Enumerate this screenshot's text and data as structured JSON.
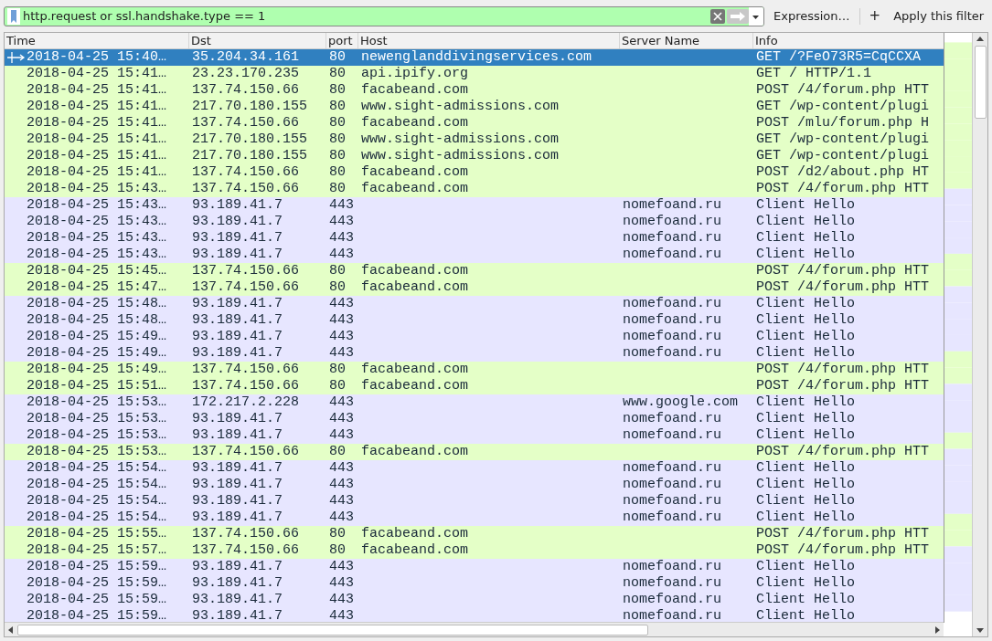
{
  "filter_bar": {
    "value": "http.request or ssl.handshake.type == 1",
    "expression_label": "Expression…",
    "add_label": "+",
    "apply_label": "Apply this filter"
  },
  "table": {
    "columns": [
      "Time",
      "Dst",
      "port",
      "Host",
      "Server Name",
      "Info"
    ],
    "rows": [
      {
        "time": "2018-04-25 15:40…",
        "dst": "35.204.34.161",
        "port": "80",
        "host": "newenglanddivingservices.com",
        "server_name": "",
        "info": "GET /?FeO73R5=CqCCXA",
        "kind": "http",
        "selected": true
      },
      {
        "time": "2018-04-25 15:41…",
        "dst": "23.23.170.235",
        "port": "80",
        "host": "api.ipify.org",
        "server_name": "",
        "info": "GET / HTTP/1.1",
        "kind": "http",
        "selected": false
      },
      {
        "time": "2018-04-25 15:41…",
        "dst": "137.74.150.66",
        "port": "80",
        "host": "facabeand.com",
        "server_name": "",
        "info": "POST /4/forum.php HTT",
        "kind": "http",
        "selected": false
      },
      {
        "time": "2018-04-25 15:41…",
        "dst": "217.70.180.155",
        "port": "80",
        "host": "www.sight-admissions.com",
        "server_name": "",
        "info": "GET /wp-content/plugi",
        "kind": "http",
        "selected": false
      },
      {
        "time": "2018-04-25 15:41…",
        "dst": "137.74.150.66",
        "port": "80",
        "host": "facabeand.com",
        "server_name": "",
        "info": "POST /mlu/forum.php H",
        "kind": "http",
        "selected": false
      },
      {
        "time": "2018-04-25 15:41…",
        "dst": "217.70.180.155",
        "port": "80",
        "host": "www.sight-admissions.com",
        "server_name": "",
        "info": "GET /wp-content/plugi",
        "kind": "http",
        "selected": false
      },
      {
        "time": "2018-04-25 15:41…",
        "dst": "217.70.180.155",
        "port": "80",
        "host": "www.sight-admissions.com",
        "server_name": "",
        "info": "GET /wp-content/plugi",
        "kind": "http",
        "selected": false
      },
      {
        "time": "2018-04-25 15:41…",
        "dst": "137.74.150.66",
        "port": "80",
        "host": "facabeand.com",
        "server_name": "",
        "info": "POST /d2/about.php HT",
        "kind": "http",
        "selected": false
      },
      {
        "time": "2018-04-25 15:43…",
        "dst": "137.74.150.66",
        "port": "80",
        "host": "facabeand.com",
        "server_name": "",
        "info": "POST /4/forum.php HTT",
        "kind": "http",
        "selected": false
      },
      {
        "time": "2018-04-25 15:43…",
        "dst": "93.189.41.7",
        "port": "443",
        "host": "",
        "server_name": "nomefoand.ru",
        "info": "Client Hello",
        "kind": "tls",
        "selected": false
      },
      {
        "time": "2018-04-25 15:43…",
        "dst": "93.189.41.7",
        "port": "443",
        "host": "",
        "server_name": "nomefoand.ru",
        "info": "Client Hello",
        "kind": "tls",
        "selected": false
      },
      {
        "time": "2018-04-25 15:43…",
        "dst": "93.189.41.7",
        "port": "443",
        "host": "",
        "server_name": "nomefoand.ru",
        "info": "Client Hello",
        "kind": "tls",
        "selected": false
      },
      {
        "time": "2018-04-25 15:43…",
        "dst": "93.189.41.7",
        "port": "443",
        "host": "",
        "server_name": "nomefoand.ru",
        "info": "Client Hello",
        "kind": "tls",
        "selected": false
      },
      {
        "time": "2018-04-25 15:45…",
        "dst": "137.74.150.66",
        "port": "80",
        "host": "facabeand.com",
        "server_name": "",
        "info": "POST /4/forum.php HTT",
        "kind": "http",
        "selected": false
      },
      {
        "time": "2018-04-25 15:47…",
        "dst": "137.74.150.66",
        "port": "80",
        "host": "facabeand.com",
        "server_name": "",
        "info": "POST /4/forum.php HTT",
        "kind": "http",
        "selected": false
      },
      {
        "time": "2018-04-25 15:48…",
        "dst": "93.189.41.7",
        "port": "443",
        "host": "",
        "server_name": "nomefoand.ru",
        "info": "Client Hello",
        "kind": "tls",
        "selected": false
      },
      {
        "time": "2018-04-25 15:48…",
        "dst": "93.189.41.7",
        "port": "443",
        "host": "",
        "server_name": "nomefoand.ru",
        "info": "Client Hello",
        "kind": "tls",
        "selected": false
      },
      {
        "time": "2018-04-25 15:49…",
        "dst": "93.189.41.7",
        "port": "443",
        "host": "",
        "server_name": "nomefoand.ru",
        "info": "Client Hello",
        "kind": "tls",
        "selected": false
      },
      {
        "time": "2018-04-25 15:49…",
        "dst": "93.189.41.7",
        "port": "443",
        "host": "",
        "server_name": "nomefoand.ru",
        "info": "Client Hello",
        "kind": "tls",
        "selected": false
      },
      {
        "time": "2018-04-25 15:49…",
        "dst": "137.74.150.66",
        "port": "80",
        "host": "facabeand.com",
        "server_name": "",
        "info": "POST /4/forum.php HTT",
        "kind": "http",
        "selected": false
      },
      {
        "time": "2018-04-25 15:51…",
        "dst": "137.74.150.66",
        "port": "80",
        "host": "facabeand.com",
        "server_name": "",
        "info": "POST /4/forum.php HTT",
        "kind": "http",
        "selected": false
      },
      {
        "time": "2018-04-25 15:53…",
        "dst": "172.217.2.228",
        "port": "443",
        "host": "",
        "server_name": "www.google.com",
        "info": "Client Hello",
        "kind": "tls",
        "selected": false
      },
      {
        "time": "2018-04-25 15:53…",
        "dst": "93.189.41.7",
        "port": "443",
        "host": "",
        "server_name": "nomefoand.ru",
        "info": "Client Hello",
        "kind": "tls",
        "selected": false
      },
      {
        "time": "2018-04-25 15:53…",
        "dst": "93.189.41.7",
        "port": "443",
        "host": "",
        "server_name": "nomefoand.ru",
        "info": "Client Hello",
        "kind": "tls",
        "selected": false
      },
      {
        "time": "2018-04-25 15:53…",
        "dst": "137.74.150.66",
        "port": "80",
        "host": "facabeand.com",
        "server_name": "",
        "info": "POST /4/forum.php HTT",
        "kind": "http",
        "selected": false
      },
      {
        "time": "2018-04-25 15:54…",
        "dst": "93.189.41.7",
        "port": "443",
        "host": "",
        "server_name": "nomefoand.ru",
        "info": "Client Hello",
        "kind": "tls",
        "selected": false
      },
      {
        "time": "2018-04-25 15:54…",
        "dst": "93.189.41.7",
        "port": "443",
        "host": "",
        "server_name": "nomefoand.ru",
        "info": "Client Hello",
        "kind": "tls",
        "selected": false
      },
      {
        "time": "2018-04-25 15:54…",
        "dst": "93.189.41.7",
        "port": "443",
        "host": "",
        "server_name": "nomefoand.ru",
        "info": "Client Hello",
        "kind": "tls",
        "selected": false
      },
      {
        "time": "2018-04-25 15:54…",
        "dst": "93.189.41.7",
        "port": "443",
        "host": "",
        "server_name": "nomefoand.ru",
        "info": "Client Hello",
        "kind": "tls",
        "selected": false
      },
      {
        "time": "2018-04-25 15:55…",
        "dst": "137.74.150.66",
        "port": "80",
        "host": "facabeand.com",
        "server_name": "",
        "info": "POST /4/forum.php HTT",
        "kind": "http",
        "selected": false
      },
      {
        "time": "2018-04-25 15:57…",
        "dst": "137.74.150.66",
        "port": "80",
        "host": "facabeand.com",
        "server_name": "",
        "info": "POST /4/forum.php HTT",
        "kind": "http",
        "selected": false
      },
      {
        "time": "2018-04-25 15:59…",
        "dst": "93.189.41.7",
        "port": "443",
        "host": "",
        "server_name": "nomefoand.ru",
        "info": "Client Hello",
        "kind": "tls",
        "selected": false
      },
      {
        "time": "2018-04-25 15:59…",
        "dst": "93.189.41.7",
        "port": "443",
        "host": "",
        "server_name": "nomefoand.ru",
        "info": "Client Hello",
        "kind": "tls",
        "selected": false
      },
      {
        "time": "2018-04-25 15:59…",
        "dst": "93.189.41.7",
        "port": "443",
        "host": "",
        "server_name": "nomefoand.ru",
        "info": "Client Hello",
        "kind": "tls",
        "selected": false
      },
      {
        "time": "2018-04-25 15:59…",
        "dst": "93.189.41.7",
        "port": "443",
        "host": "",
        "server_name": "nomefoand.ru",
        "info": "Client Hello",
        "kind": "tls",
        "selected": false
      }
    ]
  }
}
